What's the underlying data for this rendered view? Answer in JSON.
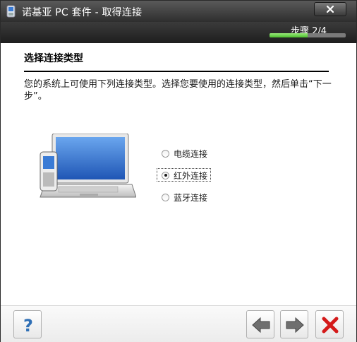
{
  "window": {
    "title": "诺基亚 PC 套件 - 取得连接",
    "step_label": "步骤 2/4",
    "progress_fraction": 0.5
  },
  "main": {
    "heading": "选择连接类型",
    "description": "您的系统上可使用下列连接类型。选择您要使用的连接类型，然后单击“下一步”。",
    "options": [
      {
        "label": "电缆连接",
        "checked": false
      },
      {
        "label": "红外连接",
        "checked": true
      },
      {
        "label": "蓝牙连接",
        "checked": false
      }
    ]
  },
  "footer": {
    "help_icon": "question-mark-icon",
    "back_icon": "arrow-left-icon",
    "next_icon": "arrow-right-icon",
    "cancel_icon": "red-x-icon"
  },
  "colors": {
    "titlebar": "#2e2e2e",
    "progress": "#4cbf2e",
    "help_blue": "#2f6fb5",
    "cancel_red": "#d41a1a"
  }
}
